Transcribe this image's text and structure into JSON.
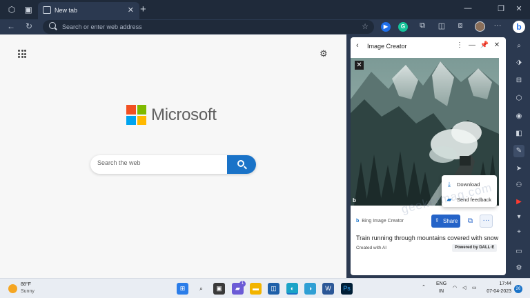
{
  "browser": {
    "tab_title": "New tab",
    "address_placeholder": "Search or enter web address",
    "tab_close": "✕",
    "newtab_symbol": "+",
    "ext_letters": [
      "▶",
      "G"
    ],
    "more_symbol": "···"
  },
  "newtab_page": {
    "brand": "Microsoft",
    "search_placeholder": "Search the web",
    "logo_colors": [
      "#f25022",
      "#7fba00",
      "#00a4ef",
      "#ffb900"
    ]
  },
  "image_creator": {
    "title": "Image Creator",
    "menu": {
      "download_label": "Download",
      "feedback_label": "Send feedback"
    },
    "brand_label": "Bing Image Creator",
    "share_label": "Share",
    "prompt": "Train running through mountains covered with snow",
    "created_label": "Created with AI",
    "powered_label": "Powered by DALL·E",
    "watermark": "geekermag.com"
  },
  "taskbar": {
    "weather_temp": "88°F",
    "weather_condition": "Sunny",
    "language": "ENG",
    "region": "IN",
    "time": "17:44",
    "date": "07-04-2023",
    "notification_count": "26",
    "chat_badge": "1"
  },
  "colors": {
    "accent": "#1a73c8",
    "chrome_dark": "#1f2a3a",
    "chrome": "#2b3950"
  }
}
